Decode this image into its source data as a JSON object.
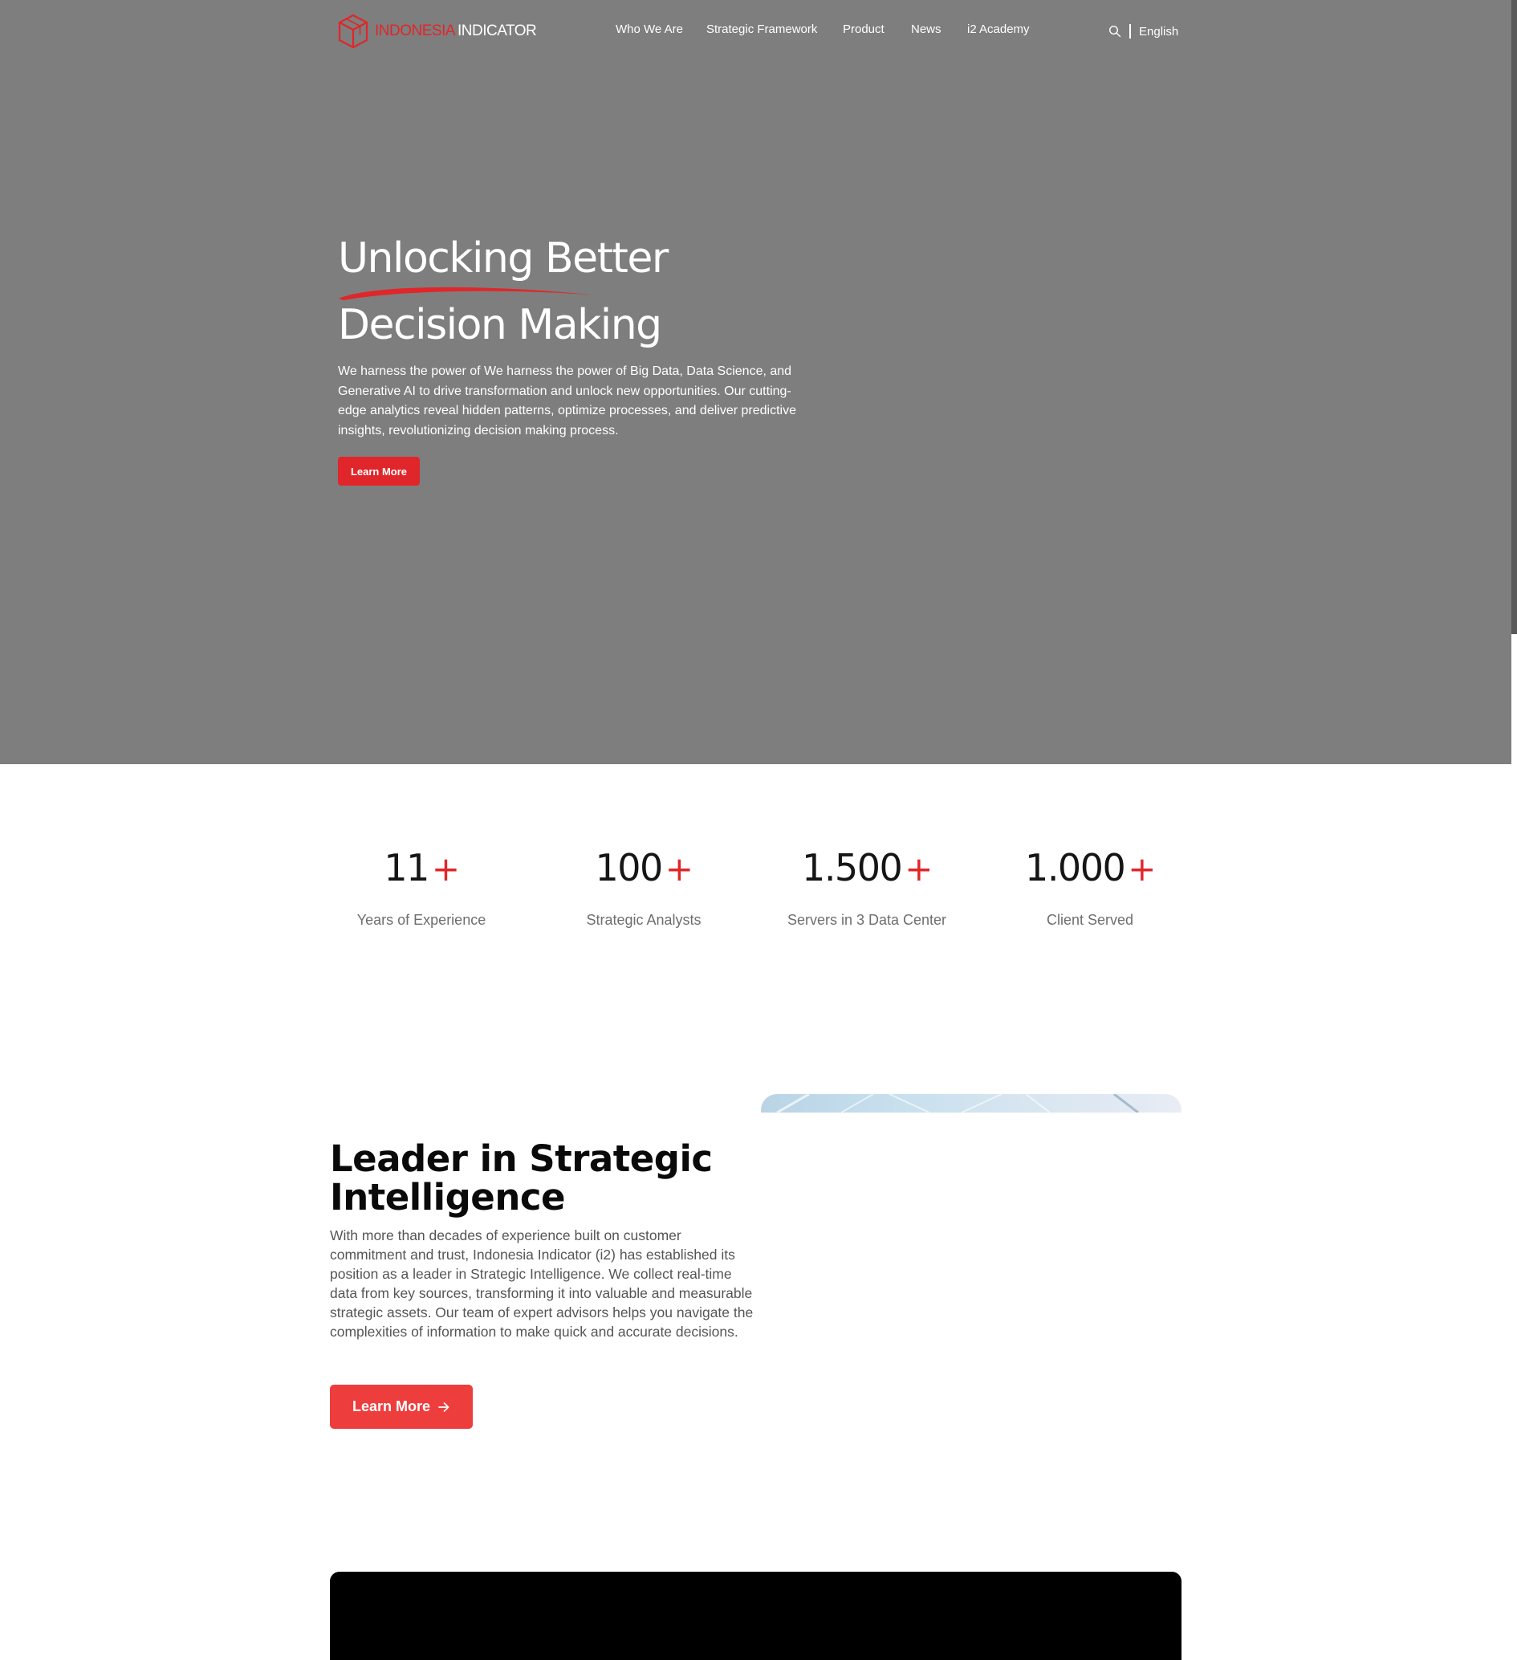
{
  "brand": {
    "logo_part1": "INDONESIA",
    "logo_part2": "INDICATOR",
    "accent_color": "#e0262a"
  },
  "nav": {
    "items": [
      {
        "label": "Who We Are"
      },
      {
        "label": "Strategic Framework"
      },
      {
        "label": "Product"
      },
      {
        "label": "News"
      },
      {
        "label": "i2 Academy"
      }
    ],
    "search_icon": "search-icon",
    "language": "English"
  },
  "hero": {
    "title_line1": "Unlocking Better",
    "title_line2": "Decision Making",
    "description": "We harness the power of We harness the power of Big Data, Data Science, and Generative AI to drive transformation and unlock new opportunities. Our cutting-edge analytics reveal hidden patterns, optimize processes, and deliver predictive insights, revolutionizing decision making process.",
    "button_label": "Learn More"
  },
  "stats": [
    {
      "value": "11",
      "suffix": "+",
      "label": "Years of Experience"
    },
    {
      "value": "100",
      "suffix": "+",
      "label": "Strategic Analysts"
    },
    {
      "value": "1.500",
      "suffix": "+",
      "label": "Servers in 3 Data Center"
    },
    {
      "value": "1.000",
      "suffix": "+",
      "label": "Client Served"
    }
  ],
  "about": {
    "title": "Leader in Strategic Intelligence",
    "description": "With more than decades of experience built on customer commitment and trust, Indonesia Indicator (i2) has established its position as a leader in Strategic Intelligence. We collect real-time data from key sources, transforming it into valuable and measurable strategic assets. Our team of expert advisors helps you navigate the complexities of information to make quick and accurate decisions.",
    "button_label": "Learn More",
    "button_icon": "arrow-right-icon"
  }
}
